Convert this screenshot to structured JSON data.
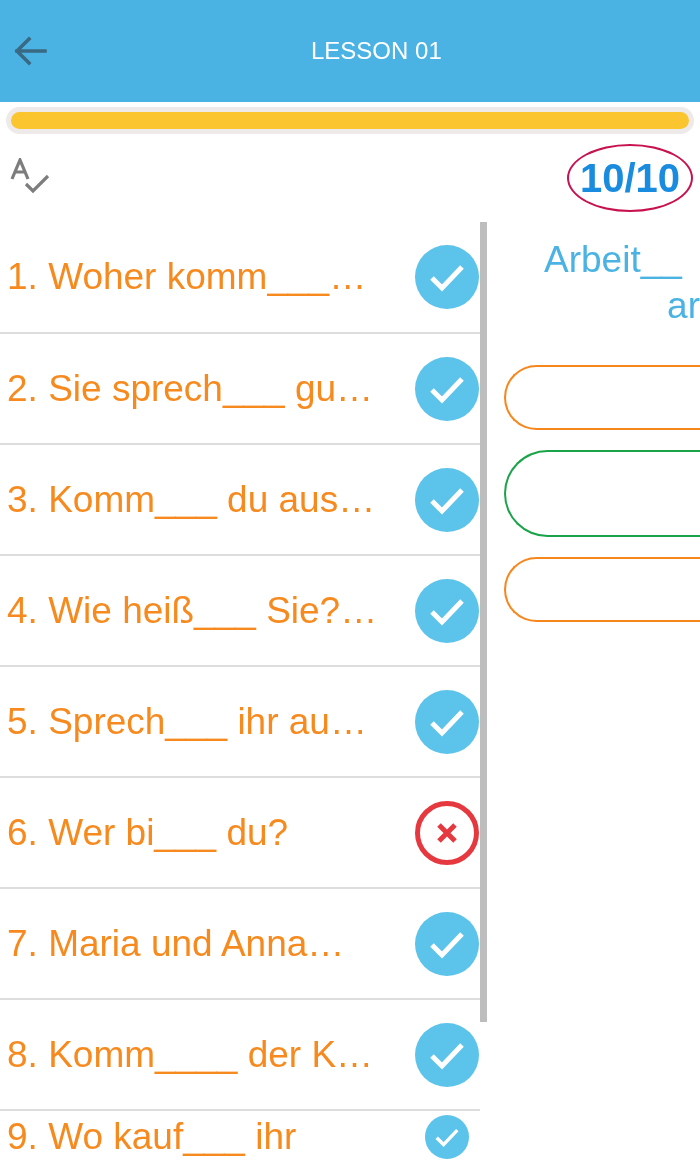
{
  "header": {
    "title": "LESSON 01"
  },
  "progress": {
    "level": 1
  },
  "score": {
    "text": "10/10"
  },
  "questions": [
    {
      "text": "1. Woher komm___…",
      "correct": true
    },
    {
      "text": "2. Sie sprech___ gu…",
      "correct": true
    },
    {
      "text": "3. Komm___ du aus…",
      "correct": true
    },
    {
      "text": "4. Wie heiß___ Sie?…",
      "correct": true
    },
    {
      "text": "5. Sprech___ ihr au…",
      "correct": true
    },
    {
      "text": "6. Wer bi___ du?",
      "correct": false
    },
    {
      "text": "7. Maria und Anna…",
      "correct": true
    },
    {
      "text": "8. Komm____ der K…",
      "correct": true
    },
    {
      "text": "9. Wo kauf___ ihr",
      "correct": true
    }
  ],
  "question_panel": {
    "prompt_lines": [
      "Arbeit__",
      "ar"
    ],
    "options": [
      {
        "color": "#f7861c"
      },
      {
        "color": "#1ba34a"
      },
      {
        "color": "#f7861c"
      }
    ]
  }
}
